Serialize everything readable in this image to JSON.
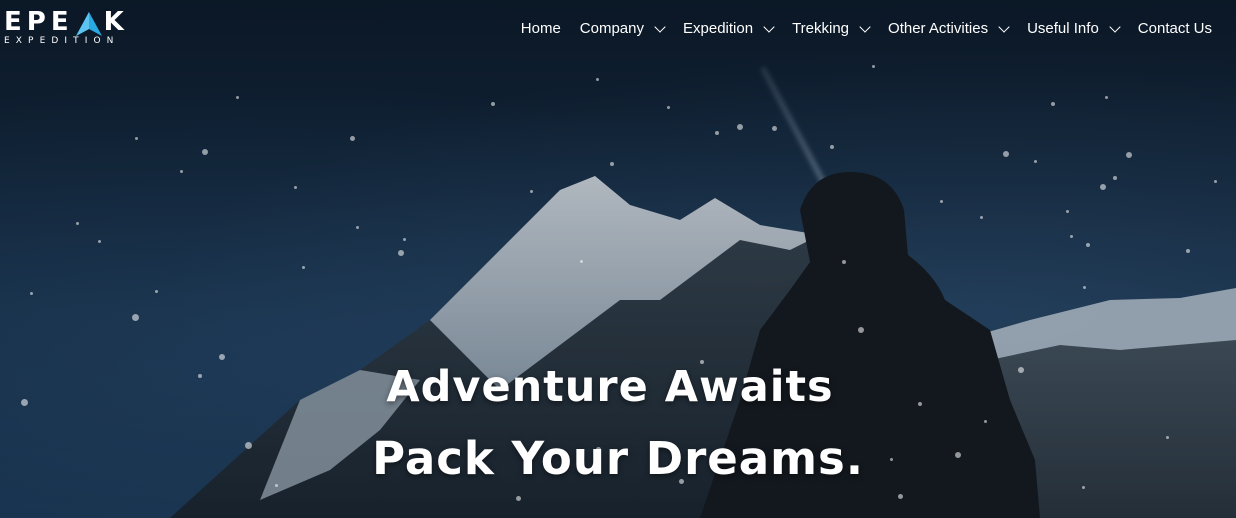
{
  "logo": {
    "main_left": "EPE",
    "main_right": "K",
    "sub": "EXPEDITION",
    "accent": "#2aa8e0"
  },
  "nav": {
    "items": [
      {
        "label": "Home",
        "dropdown": false
      },
      {
        "label": "Company",
        "dropdown": true
      },
      {
        "label": "Expedition",
        "dropdown": true
      },
      {
        "label": "Trekking",
        "dropdown": true
      },
      {
        "label": "Other Activities",
        "dropdown": true
      },
      {
        "label": "Useful Info",
        "dropdown": true
      },
      {
        "label": "Contact Us",
        "dropdown": false
      }
    ]
  },
  "hero": {
    "line1": "Adventure Awaits",
    "line2": "Pack Your Dreams."
  }
}
